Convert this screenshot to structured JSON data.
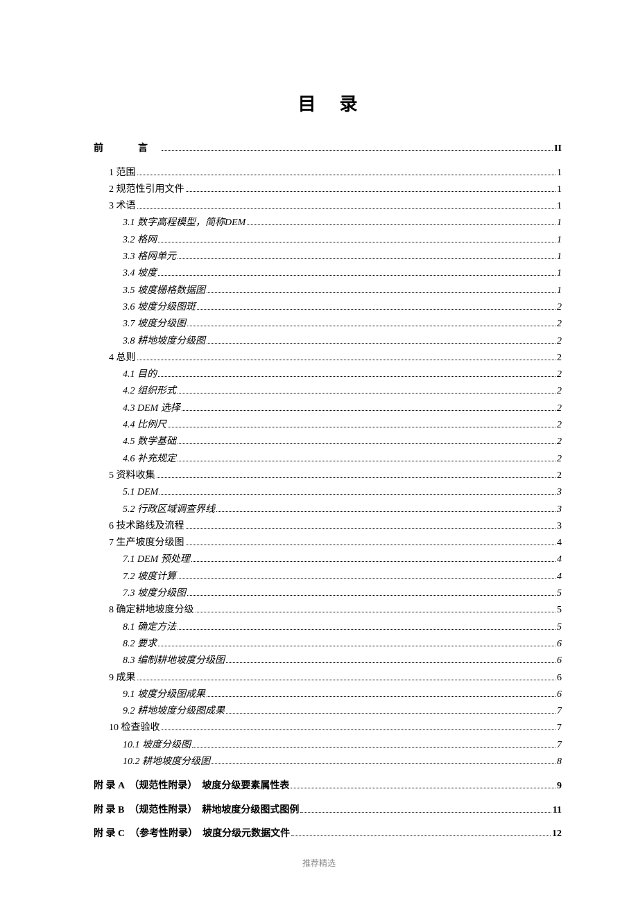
{
  "title": "目录",
  "footer": "推荐精选",
  "entries": [
    {
      "label": "前　言",
      "page": "II",
      "level": 0,
      "bold": true,
      "preface": true,
      "gap": false
    },
    {
      "label": "1 范围",
      "page": "1",
      "level": 1,
      "gap": true
    },
    {
      "label": "2 规范性引用文件",
      "page": "1",
      "level": 1
    },
    {
      "label": "3 术语",
      "page": "1",
      "level": 1
    },
    {
      "label": "3.1 数字高程模型，简称DEM",
      "page": "1",
      "level": 2,
      "italic": true
    },
    {
      "label": "3.2 格网",
      "page": "1",
      "level": 2,
      "italic": true
    },
    {
      "label": "3.3 格网单元",
      "page": "1",
      "level": 2,
      "italic": true
    },
    {
      "label": "3.4 坡度",
      "page": "1",
      "level": 2,
      "italic": true
    },
    {
      "label": "3.5 坡度栅格数据图",
      "page": "1",
      "level": 2,
      "italic": true
    },
    {
      "label": "3.6 坡度分级图斑",
      "page": "2",
      "level": 2,
      "italic": true
    },
    {
      "label": "3.7 坡度分级图",
      "page": "2",
      "level": 2,
      "italic": true
    },
    {
      "label": "3.8 耕地坡度分级图",
      "page": "2",
      "level": 2,
      "italic": true
    },
    {
      "label": "4 总则",
      "page": "2",
      "level": 1
    },
    {
      "label": "4.1 目的",
      "page": "2",
      "level": 2,
      "italic": true
    },
    {
      "label": "4.2 组织形式",
      "page": "2",
      "level": 2,
      "italic": true
    },
    {
      "label": "4.3 DEM 选择",
      "page": "2",
      "level": 2,
      "italic": true
    },
    {
      "label": "4.4 比例尺",
      "page": "2",
      "level": 2,
      "italic": true
    },
    {
      "label": "4.5 数学基础",
      "page": "2",
      "level": 2,
      "italic": true
    },
    {
      "label": "4.6 补充规定",
      "page": "2",
      "level": 2,
      "italic": true
    },
    {
      "label": "5 资料收集",
      "page": "2",
      "level": 1
    },
    {
      "label": "5.1 DEM",
      "page": "3",
      "level": 2,
      "italic": true
    },
    {
      "label": "5.2 行政区域调查界线",
      "page": "3",
      "level": 2,
      "italic": true
    },
    {
      "label": "6 技术路线及流程",
      "page": "3",
      "level": 1
    },
    {
      "label": "7 生产坡度分级图",
      "page": "4",
      "level": 1
    },
    {
      "label": "7.1 DEM 预处理",
      "page": "4",
      "level": 2,
      "italic": true
    },
    {
      "label": "7.2 坡度计算",
      "page": "4",
      "level": 2,
      "italic": true
    },
    {
      "label": "7.3 坡度分级图",
      "page": "5",
      "level": 2,
      "italic": true
    },
    {
      "label": "8 确定耕地坡度分级",
      "page": "5",
      "level": 1
    },
    {
      "label": "8.1 确定方法",
      "page": "5",
      "level": 2,
      "italic": true
    },
    {
      "label": "8.2 要求",
      "page": "6",
      "level": 2,
      "italic": true
    },
    {
      "label": "8.3 编制耕地坡度分级图",
      "page": "6",
      "level": 2,
      "italic": true
    },
    {
      "label": "9 成果",
      "page": "6",
      "level": 1
    },
    {
      "label": "9.1 坡度分级图成果",
      "page": "6",
      "level": 2,
      "italic": true
    },
    {
      "label": "9.2 耕地坡度分级图成果",
      "page": "7",
      "level": 2,
      "italic": true
    },
    {
      "label": "10 检查验收",
      "page": "7",
      "level": 1
    },
    {
      "label": "10.1 坡度分级图",
      "page": "7",
      "level": 2,
      "italic": true
    },
    {
      "label": "10.2 耕地坡度分级图",
      "page": "8",
      "level": 2,
      "italic": true
    },
    {
      "label": "附 录 A　（规范性附录）　坡度分级要素属性表",
      "page": "9",
      "level": 0,
      "bold": true,
      "gap": true
    },
    {
      "label": "附 录 B　（规范性附录）　耕地坡度分级图式图例",
      "page": "11",
      "level": 0,
      "bold": true,
      "gap": true
    },
    {
      "label": "附 录 C　（参考性附录）　坡度分级元数据文件",
      "page": "12",
      "level": 0,
      "bold": true,
      "gap": true
    }
  ]
}
